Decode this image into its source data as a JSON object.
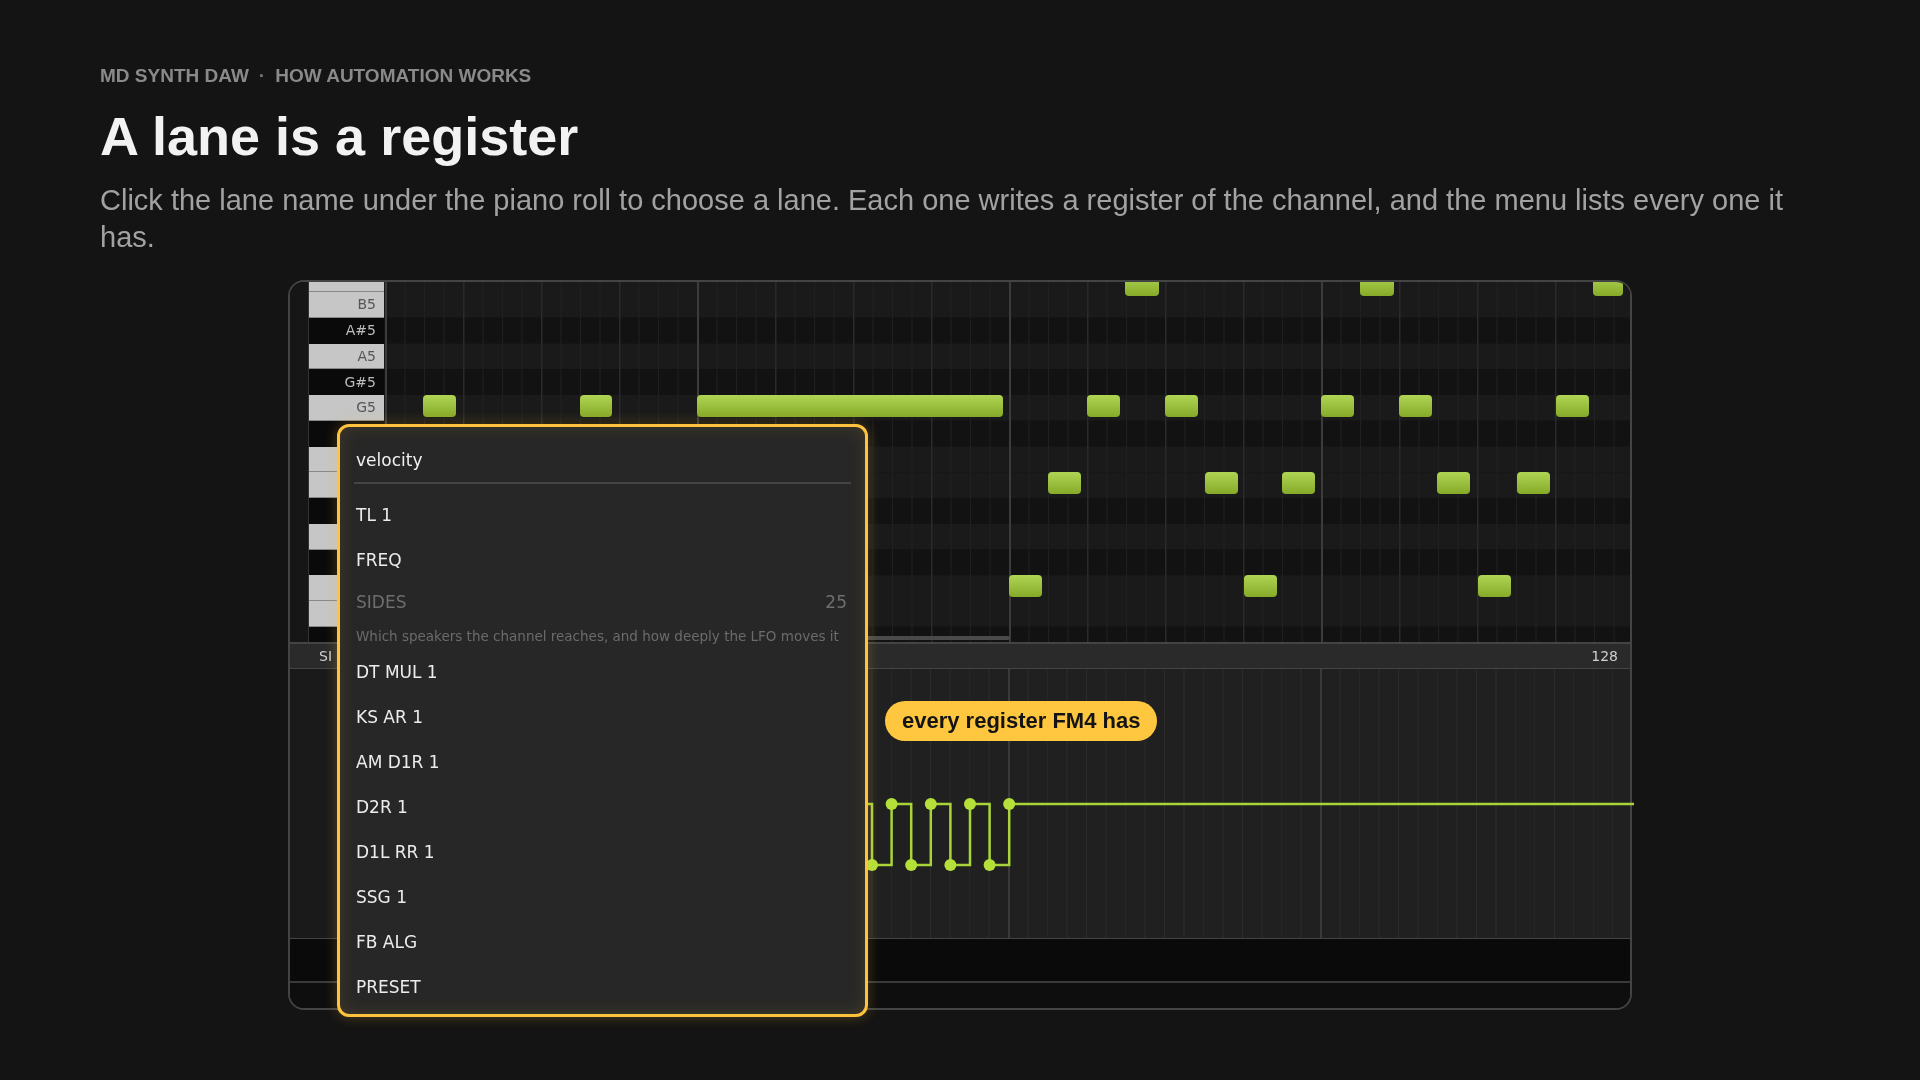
{
  "breadcrumb": [
    "MD SYNTH DAW",
    "HOW AUTOMATION WORKS"
  ],
  "separator": "·",
  "title": "A lane is a register",
  "description": "Click the lane name under the piano roll to choose a lane. Each one writes a register of the channel, and the menu lists every one it has.",
  "piano_keys": [
    {
      "kind": "white"
    },
    {
      "kind": "white",
      "label": "B5"
    },
    {
      "kind": "black",
      "label": "A#5"
    },
    {
      "kind": "white",
      "label": "A5"
    },
    {
      "kind": "black",
      "label": "G#5"
    },
    {
      "kind": "white",
      "label": "G5"
    },
    {
      "kind": "black"
    },
    {
      "kind": "white"
    },
    {
      "kind": "white"
    },
    {
      "kind": "black"
    },
    {
      "kind": "white"
    },
    {
      "kind": "black"
    },
    {
      "kind": "white"
    },
    {
      "kind": "white"
    },
    {
      "kind": "black"
    }
  ],
  "lane_bar": {
    "label": "SI",
    "max": "128"
  },
  "callout": "every register FM4 has",
  "menu": {
    "items": [
      {
        "kind": "header",
        "label": "velocity"
      },
      {
        "kind": "item",
        "label": "TL 1",
        "disabled": false
      },
      {
        "kind": "item",
        "label": "FREQ",
        "disabled": false
      },
      {
        "kind": "item",
        "label": "SIDES",
        "disabled": true,
        "value": "25",
        "description": "Which speakers the channel reaches, and how deeply the LFO moves it"
      },
      {
        "kind": "item",
        "label": "DT MUL 1",
        "disabled": false
      },
      {
        "kind": "item",
        "label": "KS AR 1",
        "disabled": false
      },
      {
        "kind": "item",
        "label": "AM D1R 1",
        "disabled": false
      },
      {
        "kind": "item",
        "label": "D2R 1",
        "disabled": false
      },
      {
        "kind": "item",
        "label": "D1L RR 1",
        "disabled": false
      },
      {
        "kind": "item",
        "label": "SSG 1",
        "disabled": false
      },
      {
        "kind": "item",
        "label": "FB ALG",
        "disabled": false
      },
      {
        "kind": "item",
        "label": "PRESET",
        "disabled": false
      }
    ]
  }
}
